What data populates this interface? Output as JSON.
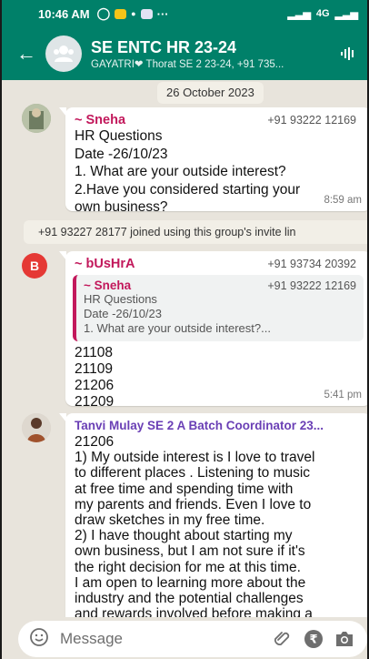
{
  "status_bar": {
    "time": "10:46 AM",
    "network": "4G"
  },
  "header": {
    "group_name": "SE ENTC HR 23-24",
    "members": "GAYATRI❤ Thorat SE 2 23-24, +91 735..."
  },
  "date_chip": "26 October 2023",
  "messages": [
    {
      "sender": "~ Sneha",
      "phone": "+91 93222 12169",
      "lines": [
        "HR Questions",
        "Date -26/10/23",
        "1. What are your outside interest?",
        "2.Have you considered starting your",
        "own business?"
      ],
      "time": "8:59 am"
    },
    {
      "sender": "~ bUsHrA",
      "avatar_letter": "B",
      "phone": "+91 93734 20392",
      "quote": {
        "sender": "~ Sneha",
        "phone": "+91 93222 12169",
        "lines": [
          "HR Questions",
          "Date -26/10/23",
          "1. What are your outside interest?..."
        ]
      },
      "lines": [
        "21108",
        "21109",
        "21206",
        "21209"
      ],
      "time": "5:41 pm"
    },
    {
      "sender": "Tanvi Mulay SE 2 A Batch Coordinator 23...",
      "lines": [
        "21206",
        "1) My outside interest is I love to travel",
        "to different places . Listening to music",
        "at free time and spending time with",
        "my parents and friends. Even I love to",
        "draw sketches in my free time.",
        "2) I have thought about starting my",
        "own business, but I am not sure if it's",
        "the right decision for me at this time.",
        "I am open to learning more about the",
        "industry and the potential challenges",
        "and rewards involved before making a"
      ]
    }
  ],
  "system_message": "+91 93227 28177 joined using this group's invite lin",
  "input": {
    "placeholder": "Message"
  },
  "colors": {
    "header": "#008069",
    "sender_sneha": "#c2185b",
    "sender_bushra": "#c2185b",
    "sender_tanvi": "#6a3fb5",
    "chat_bg": "#e8e4dc"
  },
  "icons": [
    "back-arrow-icon",
    "group-avatar-icon",
    "audio-call-icon",
    "emoji-icon",
    "attach-icon",
    "rupee-icon",
    "camera-icon"
  ]
}
